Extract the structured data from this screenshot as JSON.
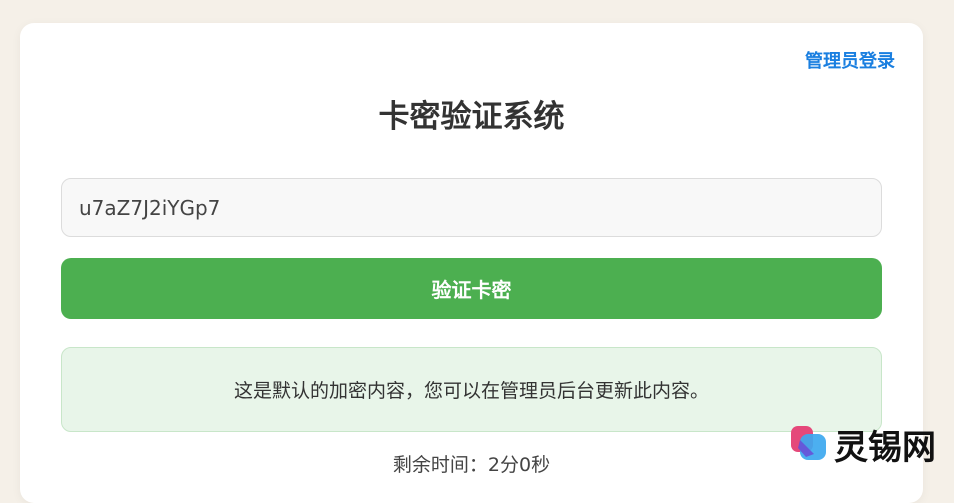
{
  "header": {
    "admin_login": "管理员登录",
    "title": "卡密验证系统"
  },
  "form": {
    "key_value": "u7aZ7J2iYGp7",
    "verify_label": "验证卡密"
  },
  "result": {
    "content": "这是默认的加密内容，您可以在管理员后台更新此内容。",
    "timer": "剩余时间：2分0秒"
  },
  "watermark": {
    "text": "灵锡网"
  },
  "colors": {
    "accent": "#1a7fe0",
    "button": "#4caf50",
    "content_bg": "#e8f5e9"
  }
}
